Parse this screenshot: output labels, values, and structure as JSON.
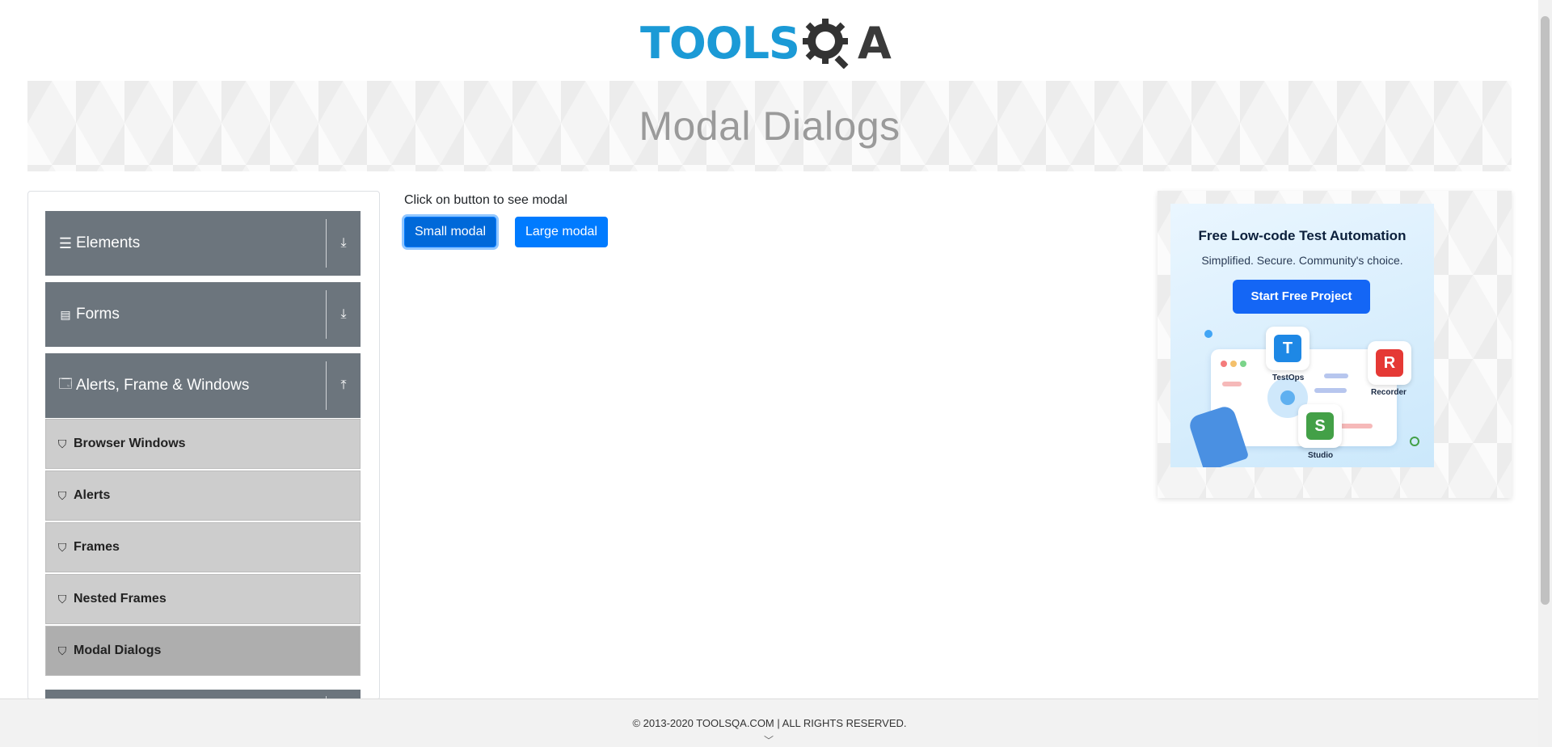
{
  "brand": {
    "logo_main": "TOOLS",
    "logo_suffix": "A"
  },
  "banner": {
    "title": "Modal Dialogs"
  },
  "sidebar": {
    "groups": [
      {
        "label": "Elements",
        "icon": "hamburger-icon",
        "toggle": "download-icon"
      },
      {
        "label": "Forms",
        "icon": "document-icon",
        "toggle": "download-icon"
      },
      {
        "label": "Alerts, Frame & Windows",
        "icon": "window-icon",
        "toggle": "upload-icon"
      }
    ],
    "items": [
      {
        "label": "Browser Windows"
      },
      {
        "label": "Alerts"
      },
      {
        "label": "Frames"
      },
      {
        "label": "Nested Frames"
      },
      {
        "label": "Modal Dialogs"
      }
    ]
  },
  "main": {
    "instruction": "Click on button to see modal",
    "small_button": "Small modal",
    "large_button": "Large modal"
  },
  "ad": {
    "title": "Free Low-code Test Automation",
    "subtitle": "Simplified. Secure. Community's choice.",
    "cta": "Start Free Project",
    "tiles": [
      {
        "label": "TestOps",
        "letter": "T",
        "color": "#1e88e5"
      },
      {
        "label": "Recorder",
        "letter": "R",
        "color": "#e53935"
      },
      {
        "label": "Studio",
        "letter": "S",
        "color": "#43a047"
      }
    ]
  },
  "footer": {
    "copyright": "© 2013-2020 TOOLSQA.COM | ALL RIGHTS RESERVED."
  },
  "colors": {
    "primary": "#007bff",
    "sidebar_group": "#6c757d",
    "sidebar_item": "#cdcdcd",
    "logo_blue": "#1b9ad6"
  }
}
